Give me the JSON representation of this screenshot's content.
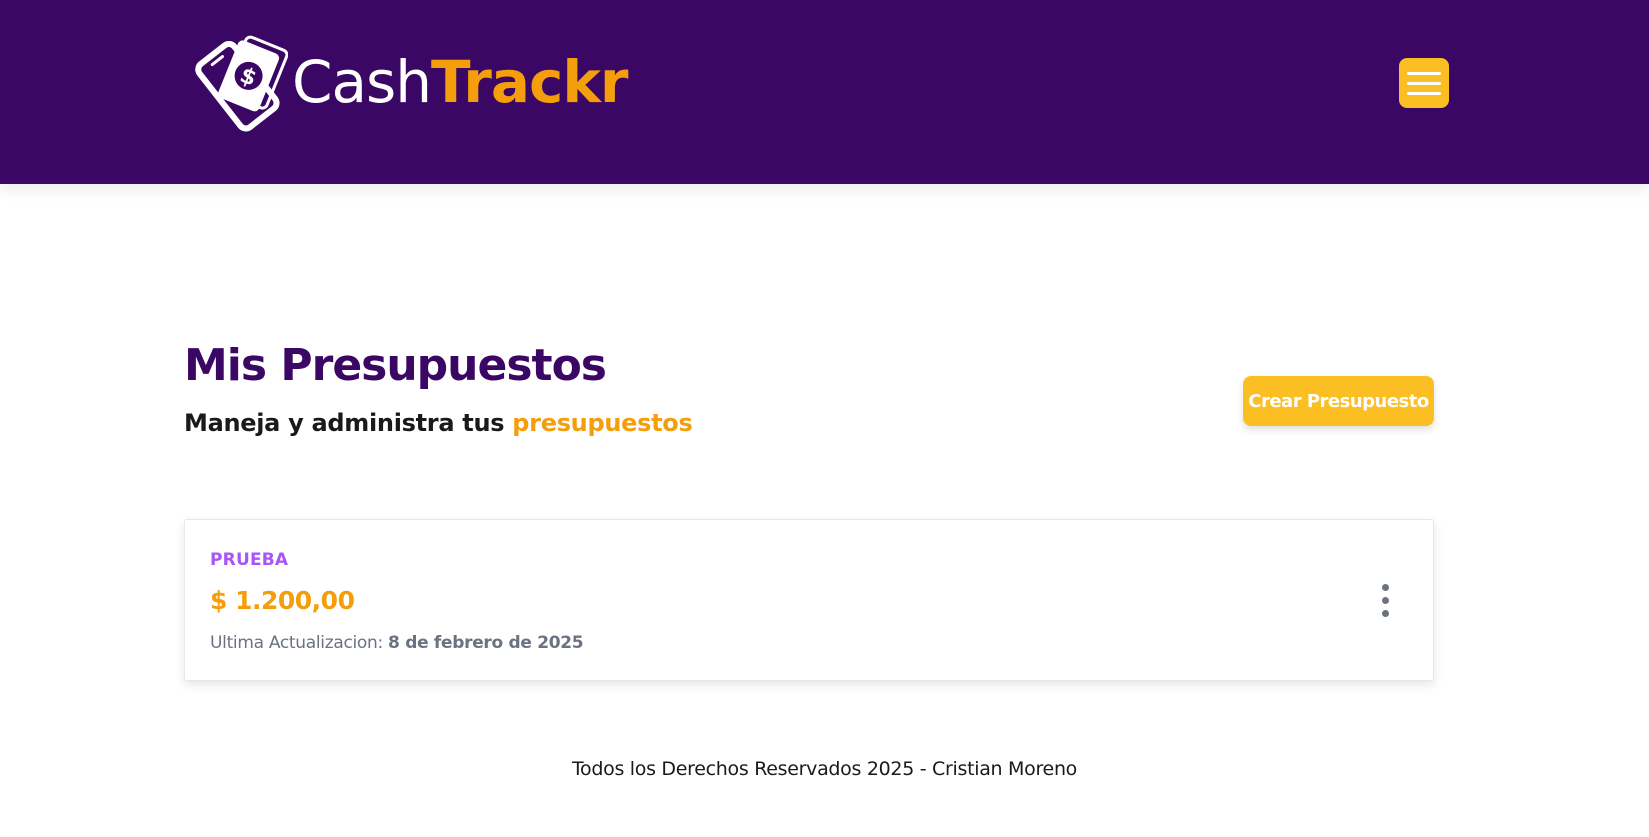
{
  "header": {
    "logo": {
      "word_cash": "Cash",
      "word_trackr": "Trackr",
      "icon": "money-phone-icon"
    },
    "menu_icon": "hamburger-menu-icon"
  },
  "main": {
    "title": "Mis Presupuestos",
    "subtitle_prefix": "Maneja y administra tus",
    "subtitle_accent": "presupuestos",
    "create_button_label": "Crear Presupuesto"
  },
  "budgets": [
    {
      "name": "PRUEBA",
      "amount": "$ 1.200,00",
      "updated_label": "Ultima Actualizacion:",
      "updated_date": "8 de febrero de 2025",
      "options_icon": "vertical-ellipsis-icon"
    }
  ],
  "footer": {
    "text": "Todos los Derechos Reservados 2025 - Cristian Moreno"
  },
  "colors": {
    "header_bg": "#3b0764",
    "brand_orange": "#f59e0b",
    "button_yellow": "#fbbf24",
    "budget_name_purple": "#a855f7",
    "muted_gray": "#6b7280"
  }
}
